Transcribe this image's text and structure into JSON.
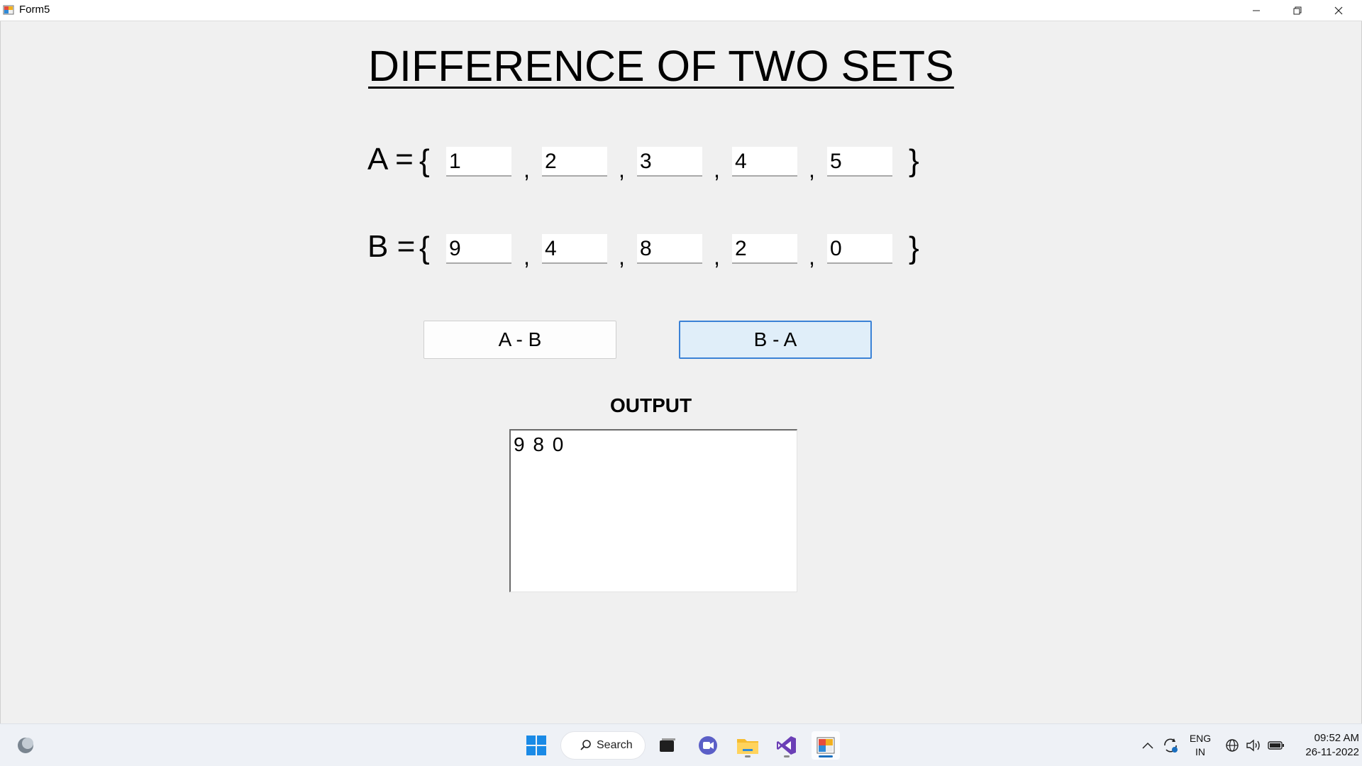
{
  "window": {
    "title": "Form5"
  },
  "form": {
    "heading": "DIFFERENCE OF TWO SETS",
    "set_a": {
      "label": "A = ",
      "open_brace": "{",
      "close_brace": "}",
      "values": [
        "1",
        "2",
        "3",
        "4",
        "5"
      ]
    },
    "set_b": {
      "label": "B = ",
      "open_brace": "{",
      "close_brace": "}",
      "values": [
        "9",
        "4",
        "8",
        "2",
        "0"
      ]
    },
    "separator": ",",
    "buttons": {
      "a_minus_b": "A - B",
      "b_minus_a": "B - A"
    },
    "output": {
      "label": "OUTPUT",
      "value": "9 8 0"
    }
  },
  "taskbar": {
    "search_label": "Search",
    "language": "ENG",
    "region": "IN",
    "time": "09:52 AM",
    "date": "26-11-2022"
  },
  "colors": {
    "accent_button_border": "#3b82d6",
    "accent_button_fill": "#e0eef9",
    "form_background": "#f0f0f0",
    "taskbar_indicator": "#1a6fbf"
  }
}
